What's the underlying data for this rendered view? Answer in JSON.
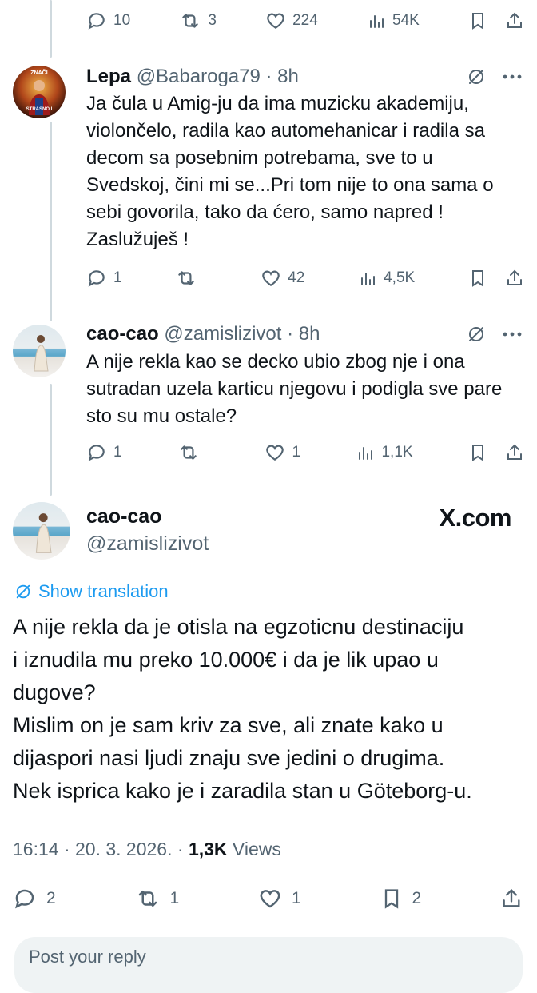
{
  "top_actions": {
    "reply_count": "10",
    "repost_count": "3",
    "like_count": "224",
    "views": "54K"
  },
  "tweets": [
    {
      "name": "Lepa",
      "handle": "@Babaroga79",
      "time": "8h",
      "text": "Ja čula u Amig-ju da ima muzicku akademiju, violončelo, radila kao automehanicar i radila sa decom sa posebnim potrebama, sve to u Svedskoj, čini mi se...Pri tom nije to ona sama o sebi govorila, tako da ćero, samo napred ! Zaslužuješ !",
      "avatar_text_top": "ZNAČI",
      "avatar_text_bottom": "STRAŠNO I",
      "reply_count": "1",
      "repost_count": "",
      "like_count": "42",
      "views": "4,5K"
    },
    {
      "name": "cao-cao",
      "handle": "@zamislizivot",
      "time": "8h",
      "text": "A nije rekla kao se decko ubio zbog nje i ona sutradan uzela karticu njegovu i podigla sve pare sto su mu ostale?",
      "reply_count": "1",
      "repost_count": "",
      "like_count": "1",
      "views": "1,1K"
    }
  ],
  "main_tweet": {
    "name": "cao-cao",
    "handle": "@zamislizivot",
    "watermark": "X.com",
    "show_translation": "Show translation",
    "text_lines": [
      "A nije rekla da je otisla na egzoticnu destinaciju",
      "i iznudila mu preko 10.000€ i da je lik upao u",
      "dugove?",
      "Mislim on je sam kriv za sve, ali znate kako u",
      "dijaspori nasi ljudi znaju sve jedini o drugima.",
      "Nek isprica kako je i zaradila stan u Göteborg-u."
    ],
    "timestamp": "16:14 · 20. 3. 2026. · ",
    "views_count": "1,3K",
    "views_label": " Views",
    "reply_count": "2",
    "repost_count": "1",
    "like_count": "1",
    "bookmark_count": "2"
  },
  "reply_placeholder": "Post your reply",
  "colors": {
    "accent": "#1d9bf0",
    "muted": "#536471",
    "text": "#0f1419",
    "line": "#cfd9de"
  },
  "icons": [
    "reply-icon",
    "repost-icon",
    "like-icon",
    "views-icon",
    "bookmark-icon",
    "share-icon",
    "grok-icon",
    "more-icon",
    "translate-icon"
  ]
}
